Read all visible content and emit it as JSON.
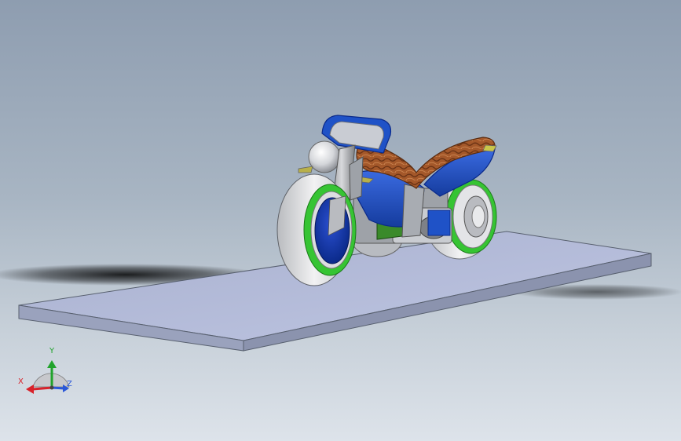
{
  "window": {
    "kind": "3d-model-viewport"
  },
  "triad": {
    "x_label": "X",
    "y_label": "Y",
    "z_label": "Z"
  },
  "colors": {
    "background_top": "#8e9db0",
    "background_bottom": "#dde3ea",
    "plate_top": "#b4bcd8",
    "plate_side": "#9aa2bd",
    "bike_blue": "#1f52c7",
    "bike_blue_dark": "#0b2a8a",
    "rim_green": "#36c433",
    "tire_grey": "#d9dadd",
    "seat_brown": "#a4582a",
    "axis_x": "#d8222a",
    "axis_y": "#21a32c",
    "axis_z": "#2a57d8"
  }
}
